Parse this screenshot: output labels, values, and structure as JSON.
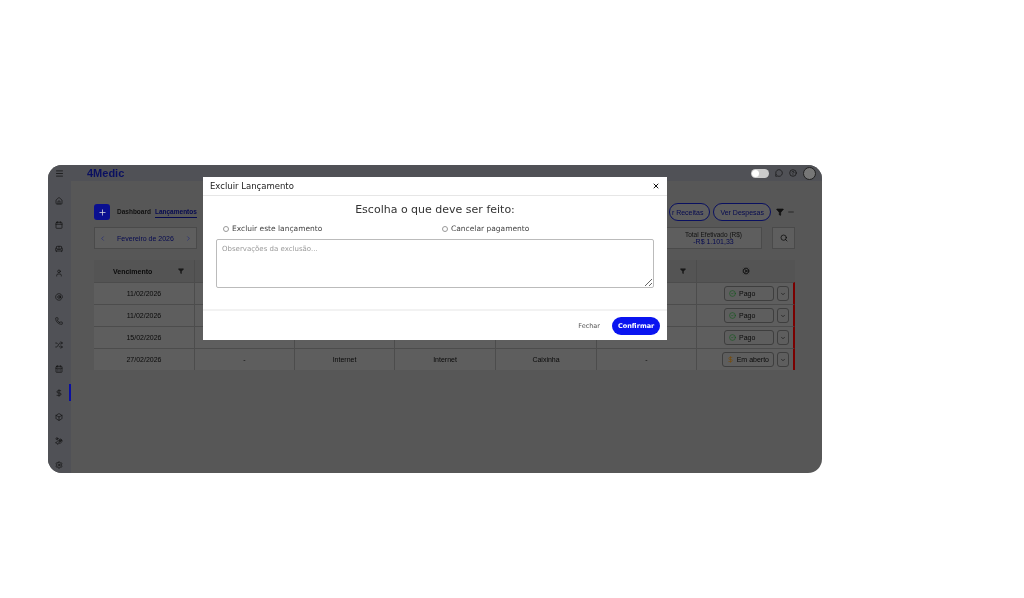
{
  "topbar": {
    "logo": "4Medic",
    "theme_toggle": {
      "on": false
    }
  },
  "sidebar": {
    "items": [
      {
        "selected": false
      },
      {
        "selected": false
      },
      {
        "selected": false
      },
      {
        "selected": false
      },
      {
        "selected": false
      },
      {
        "selected": false
      },
      {
        "selected": false
      },
      {
        "selected": false
      },
      {
        "selected": true
      },
      {
        "selected": false
      },
      {
        "selected": false
      },
      {
        "selected": false
      }
    ]
  },
  "tabs": [
    {
      "label": "Dashboard",
      "selected": false
    },
    {
      "label": "Lançamentos",
      "selected": true
    }
  ],
  "view_buttons": [
    "r Receitas",
    "Ver Despesas"
  ],
  "month": "Fevereiro de 2026",
  "total": {
    "label": "Total Efetivado (R$)",
    "value": "-R$ 1.101,33"
  },
  "table": {
    "columns": [
      {
        "label": "Vencimento",
        "filter": true
      },
      {},
      {},
      {},
      {},
      {
        "filter": true
      }
    ],
    "rows": [
      {
        "cells": [
          "11/02/2026",
          "",
          "",
          "",
          "",
          ""
        ],
        "status": {
          "kind": "paid",
          "label": "Pago"
        }
      },
      {
        "cells": [
          "11/02/2026",
          "",
          "",
          "",
          "",
          ""
        ],
        "status": {
          "kind": "paid",
          "label": "Pago"
        }
      },
      {
        "cells": [
          "15/02/2026",
          "",
          "",
          "",
          "",
          ""
        ],
        "status": {
          "kind": "paid",
          "label": "Pago"
        }
      },
      {
        "cells": [
          "27/02/2026",
          "-",
          "Internet",
          "Internet",
          "Caixinha",
          "-"
        ],
        "status": {
          "kind": "open",
          "label": "Em aberto"
        }
      }
    ]
  },
  "dialog": {
    "title": "Excluir Lançamento",
    "heading": "Escolha o que deve ser feito:",
    "options": [
      {
        "label": "Excluir este lançamento",
        "selected": false
      },
      {
        "label": "Cancelar pagamento",
        "selected": false
      }
    ],
    "notes": {
      "placeholder": "Observações da exclusão..."
    },
    "buttons": {
      "cancel": "Fechar",
      "confirm": "Confirmar"
    }
  }
}
